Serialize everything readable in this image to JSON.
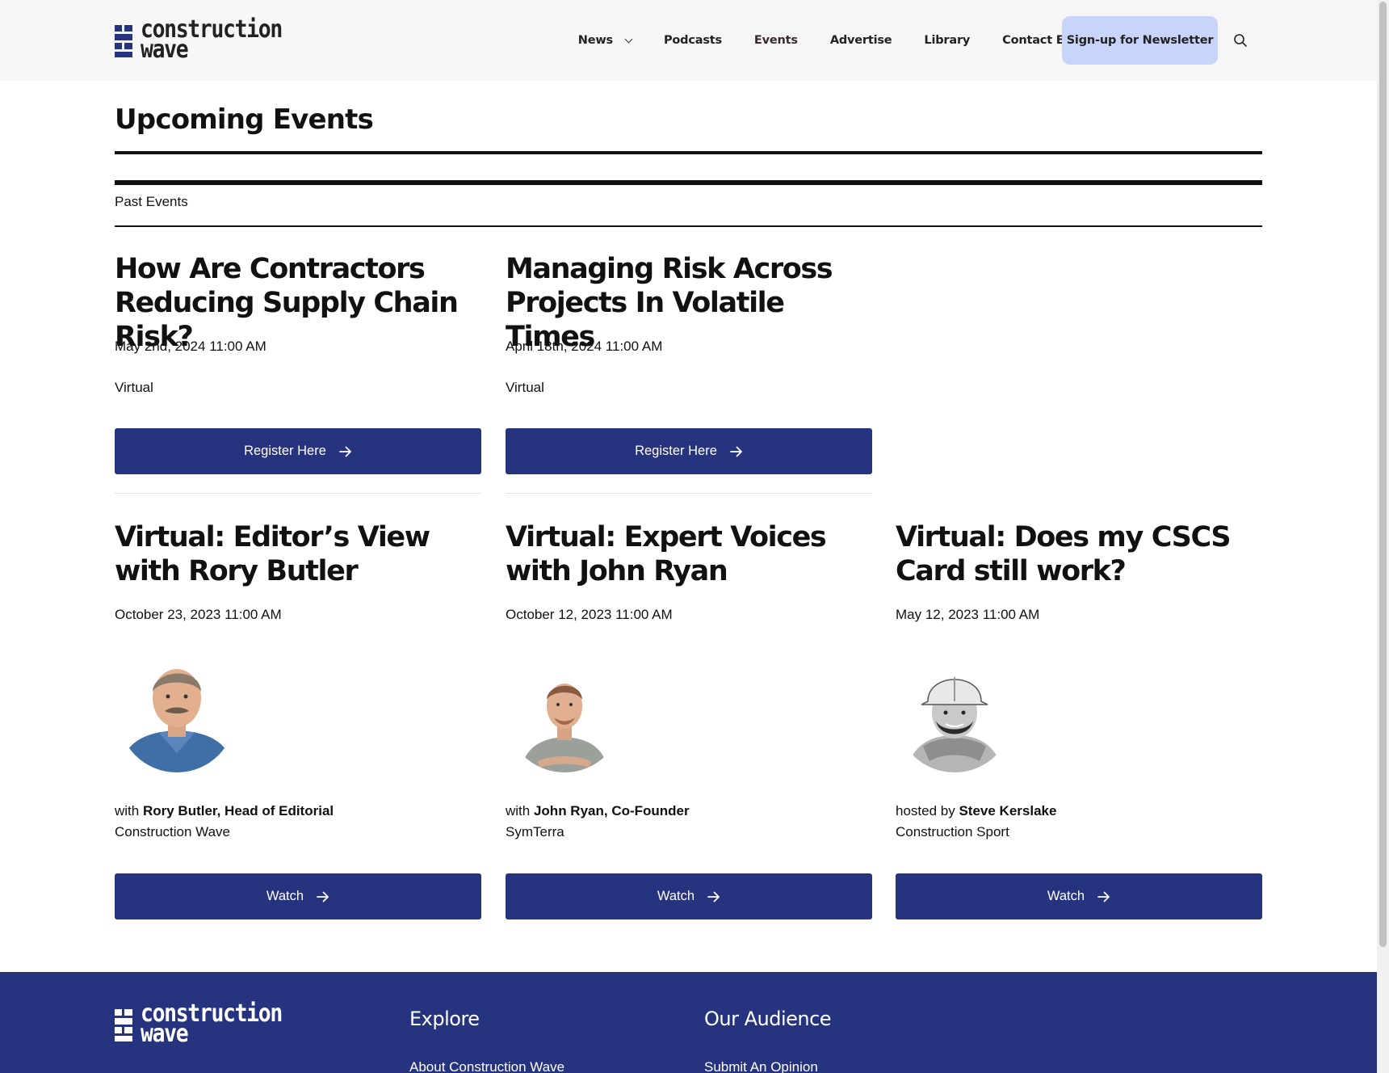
{
  "header": {
    "logo_line1": "construction",
    "logo_line2": "wave",
    "nav": [
      "News",
      "Podcasts",
      "Events",
      "Advertise",
      "Library",
      "Contact Editorial"
    ],
    "newsletter_label": "Sign-up for Newsletter"
  },
  "main": {
    "title": "Upcoming Events",
    "past_events_label": "Past Events",
    "upcoming": [
      {
        "title": "How Are Contractors Reducing Supply Chain Risk?",
        "date": "May 2nd, 2024 11:00 AM",
        "location": "Virtual",
        "button": "Register Here"
      },
      {
        "title": "Managing Risk Across Projects In Volatile Times",
        "date": "April 18th, 2024 11:00 AM",
        "location": "Virtual",
        "button": "Register Here"
      }
    ],
    "past": [
      {
        "title": "Virtual: Editor’s View with Rory Butler",
        "date": "October 23, 2023 11:00 AM",
        "host_prefix": "with",
        "host_name": "Rory Butler, Head of Editorial",
        "host_org": "Construction Wave",
        "button": "Watch"
      },
      {
        "title": "Virtual: Expert Voices with John Ryan",
        "date": "October 12, 2023 11:00 AM",
        "host_prefix": "with",
        "host_name": "John Ryan, Co-Founder",
        "host_org": "SymTerra",
        "button": "Watch"
      },
      {
        "title": "Virtual: Does my CSCS Card still work?",
        "date": "May 12, 2023 11:00 AM",
        "host_prefix": "hosted by",
        "host_name": "Steve Kerslake",
        "host_org": "Construction Sport",
        "button": "Watch"
      }
    ]
  },
  "footer": {
    "logo_line1": "construction",
    "logo_line2": "wave",
    "explore_heading": "Explore",
    "explore_link": "About Construction Wave",
    "audience_heading": "Our Audience",
    "audience_link": "Submit An Opinion"
  },
  "colors": {
    "brand": "#26337e",
    "newsletter_bg": "#c9d4fb",
    "header_bg": "#f7f7f7"
  },
  "icons": [
    "logo-mark-icon",
    "chevron-down-icon",
    "search-icon",
    "arrow-right-icon"
  ]
}
